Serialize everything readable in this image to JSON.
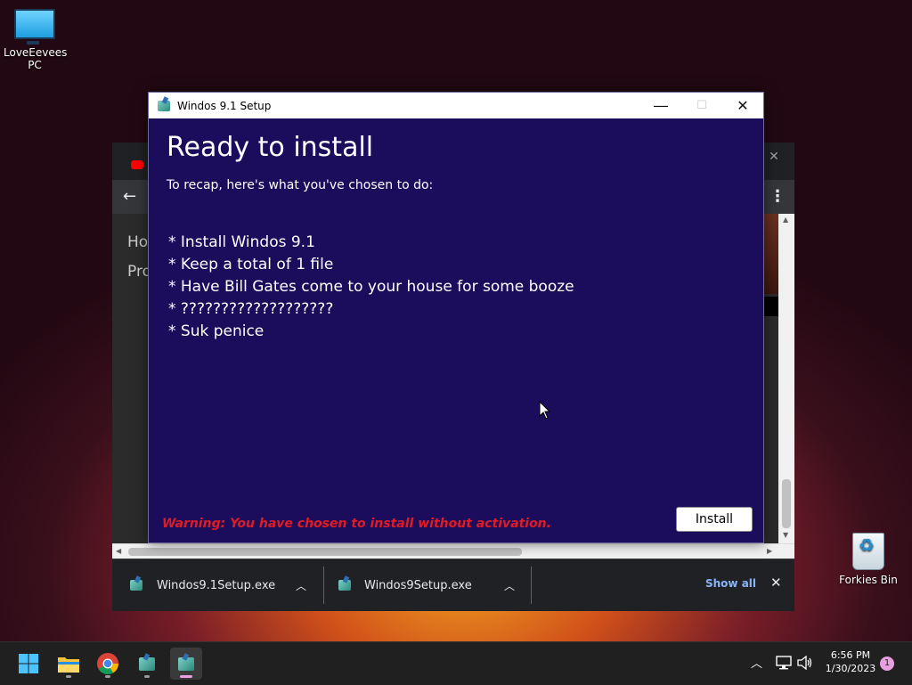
{
  "desktop": {
    "icons": [
      {
        "label": "LoveEevees PC",
        "icon": "monitor-icon"
      },
      {
        "label": "Forkies Bin",
        "icon": "recycle-bin-icon"
      }
    ]
  },
  "browser": {
    "side_text": [
      "Ho",
      "Pro"
    ],
    "downloads": [
      {
        "filename": "Windos9.1Setup.exe",
        "icon": "setup-app-icon"
      },
      {
        "filename": "Windos9Setup.exe",
        "icon": "setup-app-icon"
      }
    ],
    "show_all_label": "Show all"
  },
  "setup": {
    "window_title": "Windos 9.1 Setup",
    "heading": "Ready to install",
    "recap": "To recap, here's what you've chosen to do:",
    "items": [
      "* Install Windos 9.1",
      "* Keep a total of 1 file",
      "* Have Bill Gates come to your house for some booze",
      "* ???????????????????",
      "* Suk penice"
    ],
    "warning": "Warning: You have chosen to install without activation.",
    "install_label": "Install",
    "colors": {
      "background": "#1b0c5c",
      "warning": "#e01b24"
    }
  },
  "taskbar": {
    "apps": [
      "start-icon",
      "file-explorer-icon",
      "chrome-icon",
      "setup-app-icon",
      "setup-app-icon"
    ],
    "time": "6:56 PM",
    "date": "1/30/2023",
    "notification_count": "1"
  }
}
